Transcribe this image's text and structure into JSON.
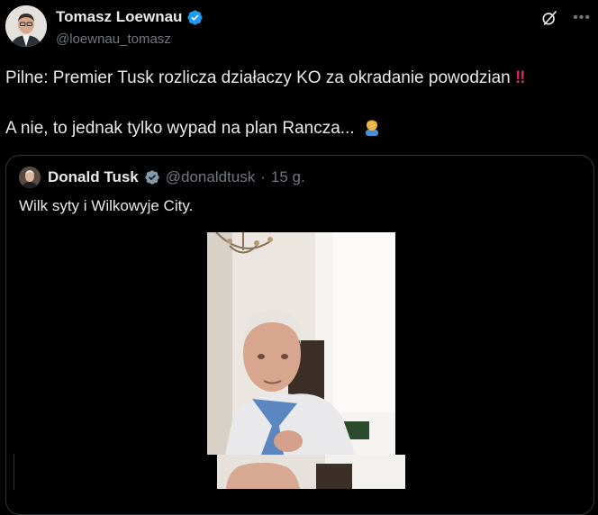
{
  "author": {
    "name": "Tomasz Loewnau",
    "handle": "@loewnau_tomasz"
  },
  "tweet": {
    "line1": "Pilne: Premier Tusk rozlicza działaczy KO za okradanie powodzian",
    "line1_emoji": "‼",
    "line2": "A nie, to jednak tylko wypad na plan Rancza...",
    "line2_emoji": "facepalm"
  },
  "quoted": {
    "name": "Donald Tusk",
    "handle": "@donaldtusk",
    "separator": "·",
    "time": "15 g.",
    "text": "Wilk syty i Wilkowyje City."
  },
  "icons": {
    "verified": "verified-badge-icon",
    "grok": "grok-icon",
    "more": "more-icon"
  },
  "colors": {
    "background": "#000000",
    "text": "#e7e9ea",
    "muted": "#71767b",
    "verified": "#1d9bf0",
    "border": "#2f3336"
  }
}
